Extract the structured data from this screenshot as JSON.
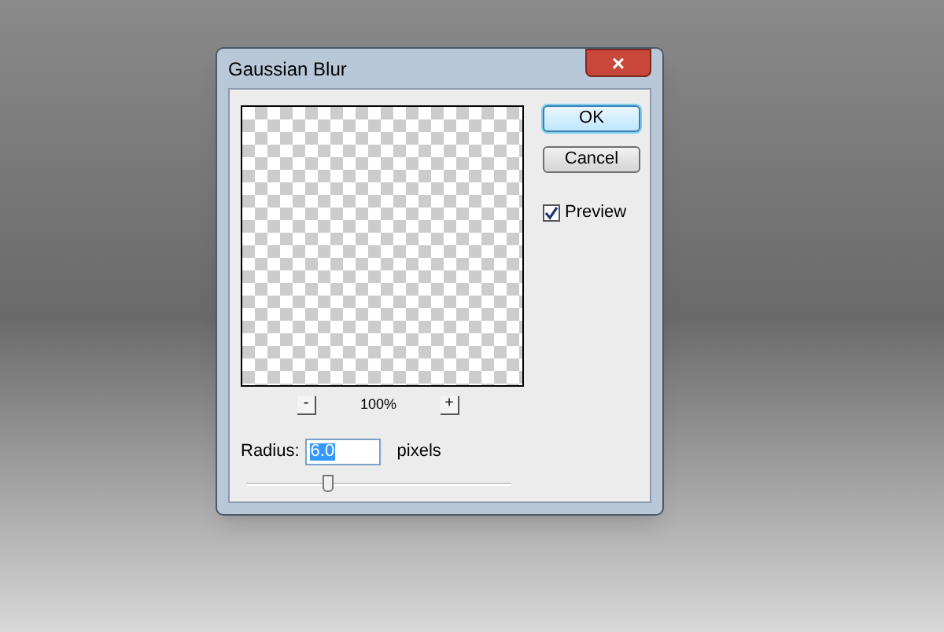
{
  "window": {
    "title": "Gaussian Blur",
    "close_label": "×"
  },
  "preview_zoom": {
    "minus": "-",
    "value": "100%",
    "plus": "+"
  },
  "buttons": [
    {
      "label": "OK",
      "default": true
    },
    {
      "label": "Cancel",
      "default": false
    }
  ],
  "preview_checkbox": {
    "label": "Preview",
    "checked": true
  },
  "radius": {
    "label": "Radius:",
    "value": "6.0",
    "value_selected": true,
    "unit": "pixels"
  },
  "slider": {
    "level": 0.3
  }
}
